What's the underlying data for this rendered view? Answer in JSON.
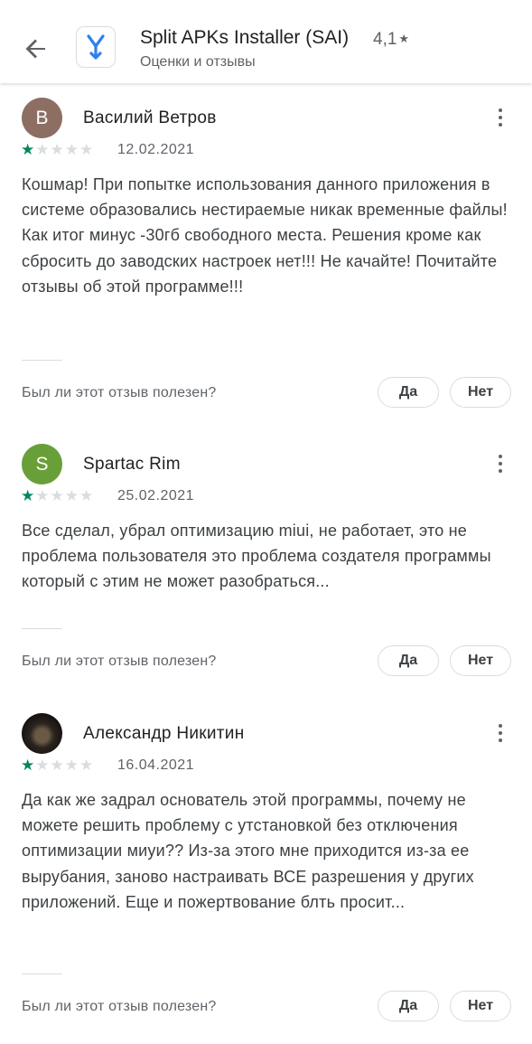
{
  "header": {
    "title": "Split APKs Installer (SAI)",
    "rating": "4,1",
    "rating_star": "★",
    "subtitle": "Оценки и отзывы",
    "icon_color": "#2f80ed"
  },
  "helpful_question": "Был ли этот отзыв полезен?",
  "yes_label": "Да",
  "no_label": "Нет",
  "reviews": [
    {
      "avatar_letter": "В",
      "avatar_color": "#8d6e63",
      "author": "Василий Ветров",
      "stars": 1,
      "date": "12.02.2021",
      "text": "Кошмар! При попытке использования данного приложения в системе образовались нестираемые никак временные файлы! Как итог минус -30гб свободного места. Решения кроме как сбросить до заводских настроек нет!!! Не качайте! Почитайте отзывы об этой программе!!!"
    },
    {
      "avatar_letter": "S",
      "avatar_color": "#689f38",
      "author": "Spartac Rim",
      "stars": 1,
      "date": "25.02.2021",
      "text": "Все сделал, убрал оптимизацию miui, не работает, это не проблема пользователя это проблема создателя программы который с этим не может разобраться..."
    },
    {
      "avatar_letter": "",
      "avatar_color": "#2b2520",
      "author": "Александр Никитин",
      "stars": 1,
      "date": "16.04.2021",
      "text": "Да как же задрал основатель этой программы, почему не можете решить проблему с утстановкой без отключения оптимизации миуи?? Из-за этого мне приходится из-за ее вырубания, заново настраивать ВСЕ разрешения у других приложений. Еще и пожертвование блть просит..."
    }
  ],
  "star_glyph": "★",
  "star_color_on": "#01875f",
  "star_color_off": "#dadce0"
}
